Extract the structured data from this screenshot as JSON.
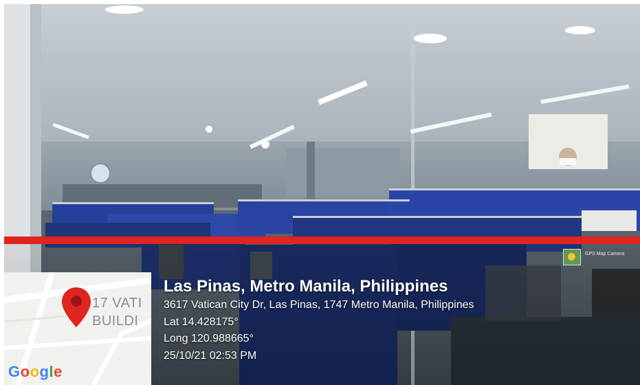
{
  "photo": {
    "description_icon": "office-photo"
  },
  "stamp": {
    "title": "Las Pinas, Metro Manila, Philippines",
    "address": "3617 Vatican City Dr, Las Pinas, 1747 Metro Manila, Philippines",
    "latitude": "Lat 14.428175°",
    "longitude": "Long 120.988665°",
    "datetime": "25/10/21 02:53 PM",
    "accent_color": "#e0241f"
  },
  "map": {
    "place_line_1": "17 VATI",
    "place_line_2": "BUILDI",
    "logo_text": "Google",
    "pin_color": "#e0241f"
  },
  "app": {
    "name": "GPS Map Camera"
  }
}
